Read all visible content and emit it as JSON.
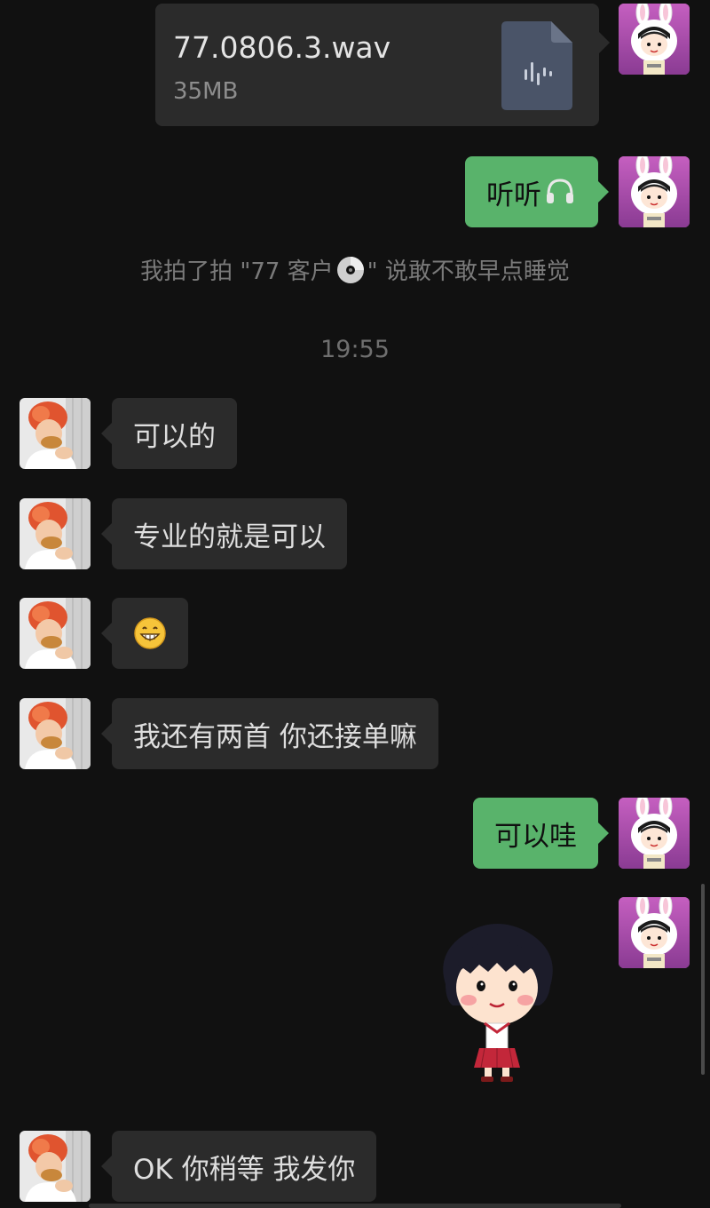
{
  "file_message": {
    "file_name": "77.0806.3.wav",
    "file_size": "35MB",
    "icon": "audio-file-icon"
  },
  "messages": {
    "self_listen": "听听",
    "self_listen_emoji": "headphones-icon",
    "system_pat": {
      "prefix": "我拍了拍 \"77 客户",
      "emoji": "disc-icon",
      "suffix": "\" 说敢不敢早点睡觉"
    },
    "timestamp": "19:55",
    "peer_1": "可以的",
    "peer_2": "专业的就是可以",
    "peer_3_emoji": "😁",
    "peer_4": "我还有两首 你还接单嘛",
    "self_2": "可以哇",
    "self_sticker": "cartoon-girl-sticker",
    "peer_5": "OK 你稍等 我发你"
  },
  "colors": {
    "background": "#111111",
    "self_bubble": "#59b36b",
    "peer_bubble": "#2b2b2b"
  }
}
